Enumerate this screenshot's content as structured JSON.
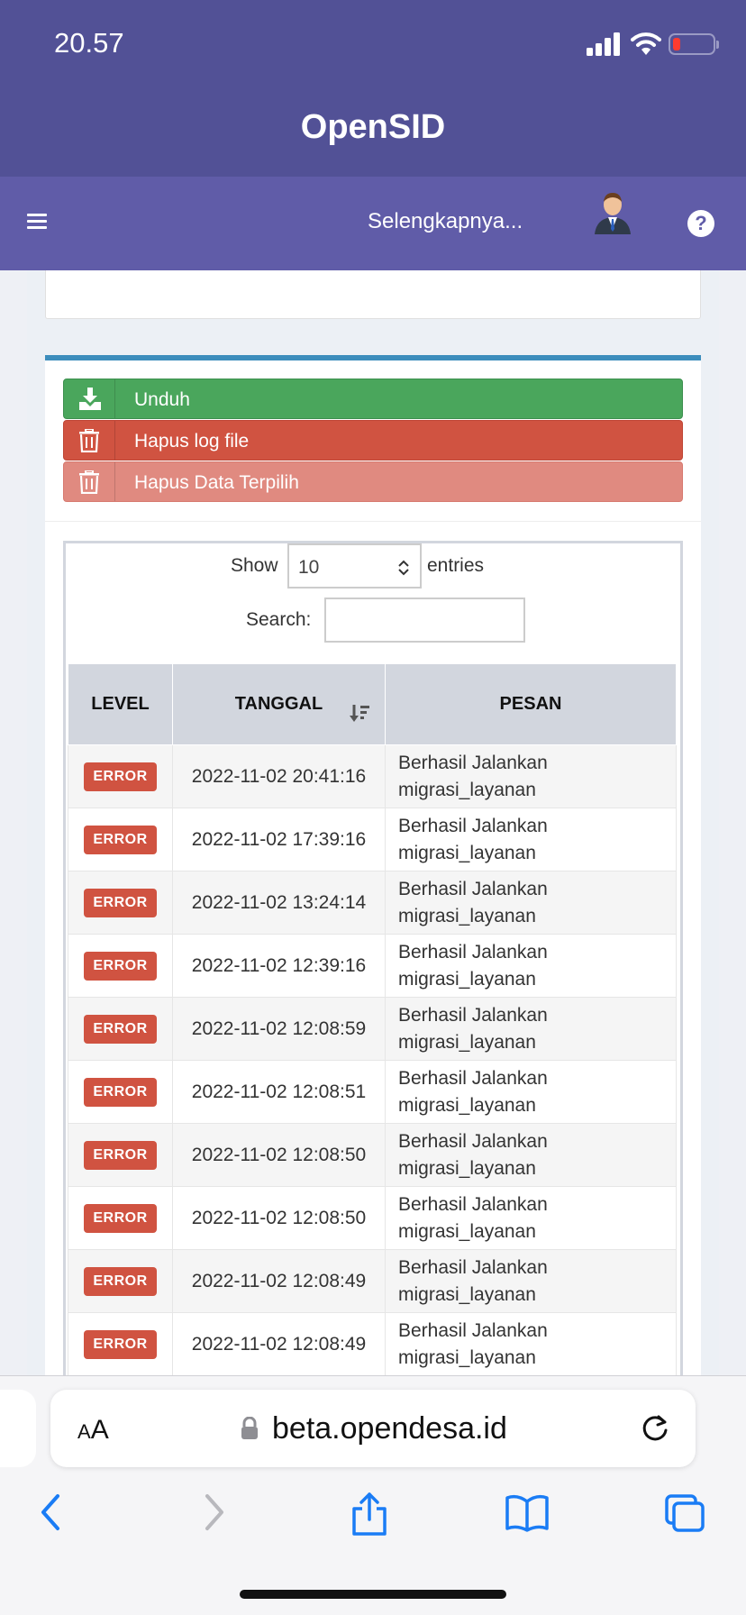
{
  "status_bar": {
    "time": "20.57"
  },
  "app": {
    "title": "OpenSID"
  },
  "navbar": {
    "more_label": "Selengkapnya...",
    "help_glyph": "?"
  },
  "actions": {
    "download_label": "Unduh",
    "delete_log_label": "Hapus log file",
    "delete_selected_label": "Hapus Data Terpilih"
  },
  "table_controls": {
    "show_label": "Show",
    "page_size": "10",
    "entries_label": "entries",
    "search_label": "Search:",
    "search_value": ""
  },
  "table": {
    "headers": [
      "LEVEL",
      "TANGGAL",
      "PESAN"
    ],
    "rows": [
      {
        "level": "ERROR",
        "date": "2022-11-02 20:41:16",
        "message": "Berhasil Jalankan migrasi_layanan"
      },
      {
        "level": "ERROR",
        "date": "2022-11-02 17:39:16",
        "message": "Berhasil Jalankan migrasi_layanan"
      },
      {
        "level": "ERROR",
        "date": "2022-11-02 13:24:14",
        "message": "Berhasil Jalankan migrasi_layanan"
      },
      {
        "level": "ERROR",
        "date": "2022-11-02 12:39:16",
        "message": "Berhasil Jalankan migrasi_layanan"
      },
      {
        "level": "ERROR",
        "date": "2022-11-02 12:08:59",
        "message": "Berhasil Jalankan migrasi_layanan"
      },
      {
        "level": "ERROR",
        "date": "2022-11-02 12:08:51",
        "message": "Berhasil Jalankan migrasi_layanan"
      },
      {
        "level": "ERROR",
        "date": "2022-11-02 12:08:50",
        "message": "Berhasil Jalankan migrasi_layanan"
      },
      {
        "level": "ERROR",
        "date": "2022-11-02 12:08:50",
        "message": "Berhasil Jalankan migrasi_layanan"
      },
      {
        "level": "ERROR",
        "date": "2022-11-02 12:08:49",
        "message": "Berhasil Jalankan migrasi_layanan"
      },
      {
        "level": "ERROR",
        "date": "2022-11-02 12:08:49",
        "message": "Berhasil Jalankan migrasi_layanan"
      }
    ]
  },
  "browser": {
    "aa_label_small": "A",
    "aa_label_large": "A",
    "url": "beta.opendesa.id"
  },
  "colors": {
    "header": "#525196",
    "navbar": "#605ca8",
    "download": "#4aa65c",
    "danger": "#d05341",
    "danger_light": "#e08a80",
    "box_accent": "#3c8dbc"
  },
  "icons": [
    "signal-icon",
    "wifi-icon",
    "battery-icon",
    "hamburger-icon",
    "user-avatar-icon",
    "help-icon",
    "download-icon",
    "trash-icon",
    "sort-icon",
    "lock-icon",
    "reload-icon",
    "back-icon",
    "forward-icon",
    "share-icon",
    "bookmarks-icon",
    "tabs-icon"
  ]
}
